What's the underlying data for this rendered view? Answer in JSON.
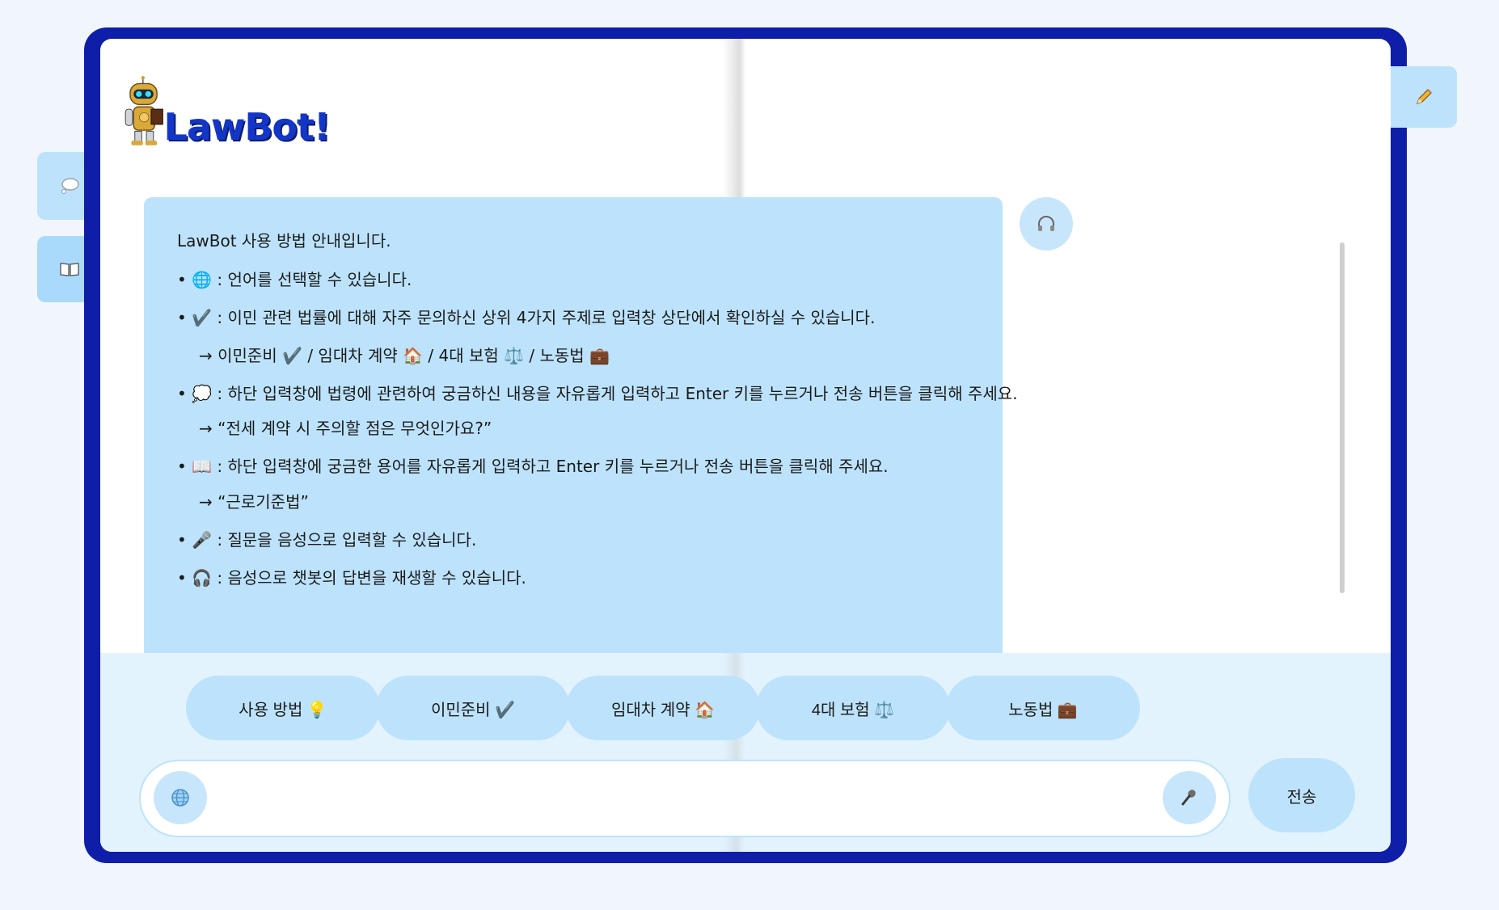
{
  "app": {
    "logo_text": "LawBot!"
  },
  "side_tabs": {
    "chat_icon": "thought-bubble-icon",
    "dictionary_icon": "book-icon",
    "edit_icon": "pencil-icon"
  },
  "message": {
    "title": "LawBot 사용 방법 안내입니다.",
    "lines": [
      "• 🌐 : 언어를 선택할 수 있습니다.",
      "• ✔️ : 이민 관련 법률에 대해 자주 문의하신 상위 4가지 주제로 입력창 상단에서 확인하실 수 있습니다.",
      "→ 이민준비 ✔️ / 임대차 계약 🏠 / 4대 보험 ⚖️ / 노동법 💼",
      "• 💭 : 하단 입력창에 법령에 관련하여 궁금하신 내용을 자유롭게 입력하고 Enter 키를 누르거나 전송 버튼을 클릭해 주세요.",
      "→ “전세 계약 시 주의할 점은 무엇인가요?”",
      "• 📖 : 하단 입력창에 궁금한 용어를 자유롭게 입력하고 Enter 키를 누르거나 전송 버튼을 클릭해 주세요.",
      "→ “근로기준법”",
      "• 🎤 : 질문을 음성으로 입력할 수 있습니다.",
      "• 🎧 : 음성으로 챗봇의 답변을 재생할 수 있습니다."
    ]
  },
  "quick_buttons": [
    {
      "label": "사용 방법 💡"
    },
    {
      "label": "이민준비 ✔️"
    },
    {
      "label": "임대차 계약 🏠"
    },
    {
      "label": "4대 보험 ⚖️"
    },
    {
      "label": "노동법 💼"
    }
  ],
  "input": {
    "placeholder": "",
    "value": ""
  },
  "send_label": "전송",
  "colors": {
    "frame": "#0f1ea8",
    "bubble": "#bde3fc",
    "bottom_bar": "#e3f3fd",
    "logo": "#1436c8"
  }
}
